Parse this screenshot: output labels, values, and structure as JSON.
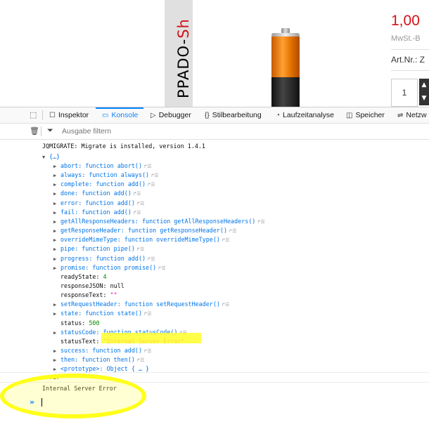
{
  "product": {
    "brand_vertical_main": "PPADO-",
    "brand_vertical_accent": "Sh",
    "price": "1,00",
    "tax_note": "MwSt.-B",
    "article_label": "Art.Nr.: Z",
    "quantity": "1",
    "accent_color": "#d51018"
  },
  "devtools": {
    "tabs": [
      {
        "label": "Inspektor",
        "icon": "inspector-icon"
      },
      {
        "label": "Konsole",
        "icon": "console-icon"
      },
      {
        "label": "Debugger",
        "icon": "debugger-icon"
      },
      {
        "label": "Stilbearbeitung",
        "icon": "style-editor-icon"
      },
      {
        "label": "Laufzeitanalyse",
        "icon": "performance-icon"
      },
      {
        "label": "Speicher",
        "icon": "memory-icon"
      },
      {
        "label": "Netzw",
        "icon": "network-icon"
      }
    ],
    "active_tab": "Konsole",
    "filter_placeholder": "Ausgabe filtern",
    "accent_color": "#0a84ff"
  },
  "console": {
    "migrate_msg": "JQMIGRATE: Migrate is installed, version 1.4.1",
    "object_header": "{…}",
    "properties": [
      {
        "key": "abort",
        "value": "function abort()"
      },
      {
        "key": "always",
        "value": "function always()"
      },
      {
        "key": "complete",
        "value": "function add()"
      },
      {
        "key": "done",
        "value": "function add()"
      },
      {
        "key": "error",
        "value": "function add()"
      },
      {
        "key": "fail",
        "value": "function add()"
      },
      {
        "key": "getAllResponseHeaders",
        "value": "function getAllResponseHeaders()"
      },
      {
        "key": "getResponseHeader",
        "value": "function getResponseHeader()"
      },
      {
        "key": "overrideMimeType",
        "value": "function overrideMimeType()"
      },
      {
        "key": "pipe",
        "value": "function pipe()"
      },
      {
        "key": "progress",
        "value": "function add()"
      },
      {
        "key": "promise",
        "value": "function promise()"
      },
      {
        "key": "readyState",
        "value": "4"
      },
      {
        "key": "responseJSON",
        "value": "null"
      },
      {
        "key": "responseText",
        "value": "\"\""
      },
      {
        "key": "setRequestHeader",
        "value": "function setRequestHeader()"
      },
      {
        "key": "state",
        "value": "function state()"
      },
      {
        "key": "status",
        "value": "500"
      },
      {
        "key": "statusCode",
        "value": "function statusCode()"
      },
      {
        "key": "statusText",
        "value": "\"Internal Server Error\""
      },
      {
        "key": "success",
        "value": "function add()"
      },
      {
        "key": "then",
        "value": "function then()"
      },
      {
        "key": "<prototype>",
        "value": "Object { … }"
      }
    ],
    "error_word": "error",
    "error_message": "Internal Server Error",
    "prompt_symbol": "»"
  }
}
